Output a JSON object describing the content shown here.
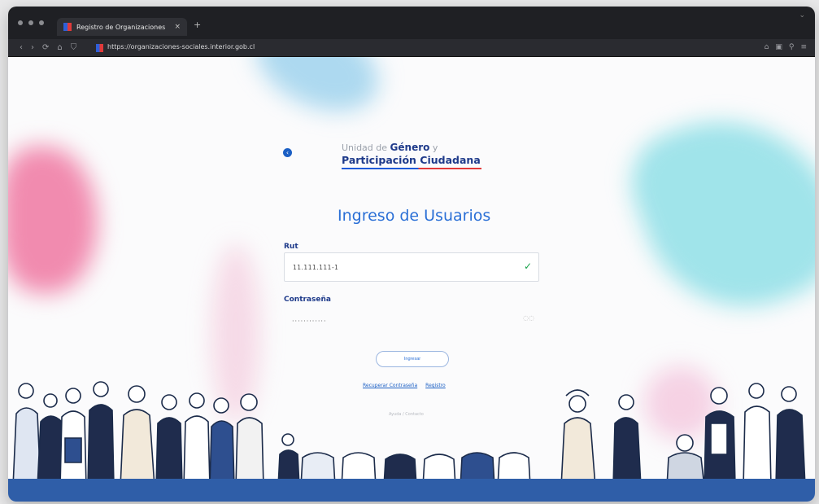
{
  "browser": {
    "tab_title": "Registro de Organizaciones",
    "tab_close": "×",
    "new_tab": "+",
    "url": "https://organizaciones-sociales.interior.gob.cl",
    "nav_back": "‹",
    "nav_forward": "›",
    "nav_reload": "⟳",
    "nav_home": "⌂",
    "nav_shield": "⛉",
    "right_icons": [
      "⌂",
      "▣",
      "⚲",
      "≡"
    ],
    "top_chevron": "⌄"
  },
  "logo": {
    "line1_prefix": "Unidad de",
    "line1_bold": "Género",
    "line1_suffix": "y",
    "line2": "Participación Ciudadana"
  },
  "back_icon_glyph": "‹",
  "login": {
    "heading": "Ingreso de Usuarios",
    "rut_label": "Rut",
    "rut_value": "11.111.111-1",
    "rut_check": "✓",
    "password_label": "Contraseña",
    "password_value": "············",
    "submit_label": "Ingresar",
    "recover_link": "Recuperar Contraseña",
    "register_link": "Registro",
    "faint_text": "Ayuda / Contacto"
  },
  "colors": {
    "accent_blue": "#2a6fd6",
    "logo_blue": "#1e3a8a",
    "logo_red": "#e23a3a",
    "check_green": "#17a34a",
    "footer_blue": "#2f5ea8"
  }
}
